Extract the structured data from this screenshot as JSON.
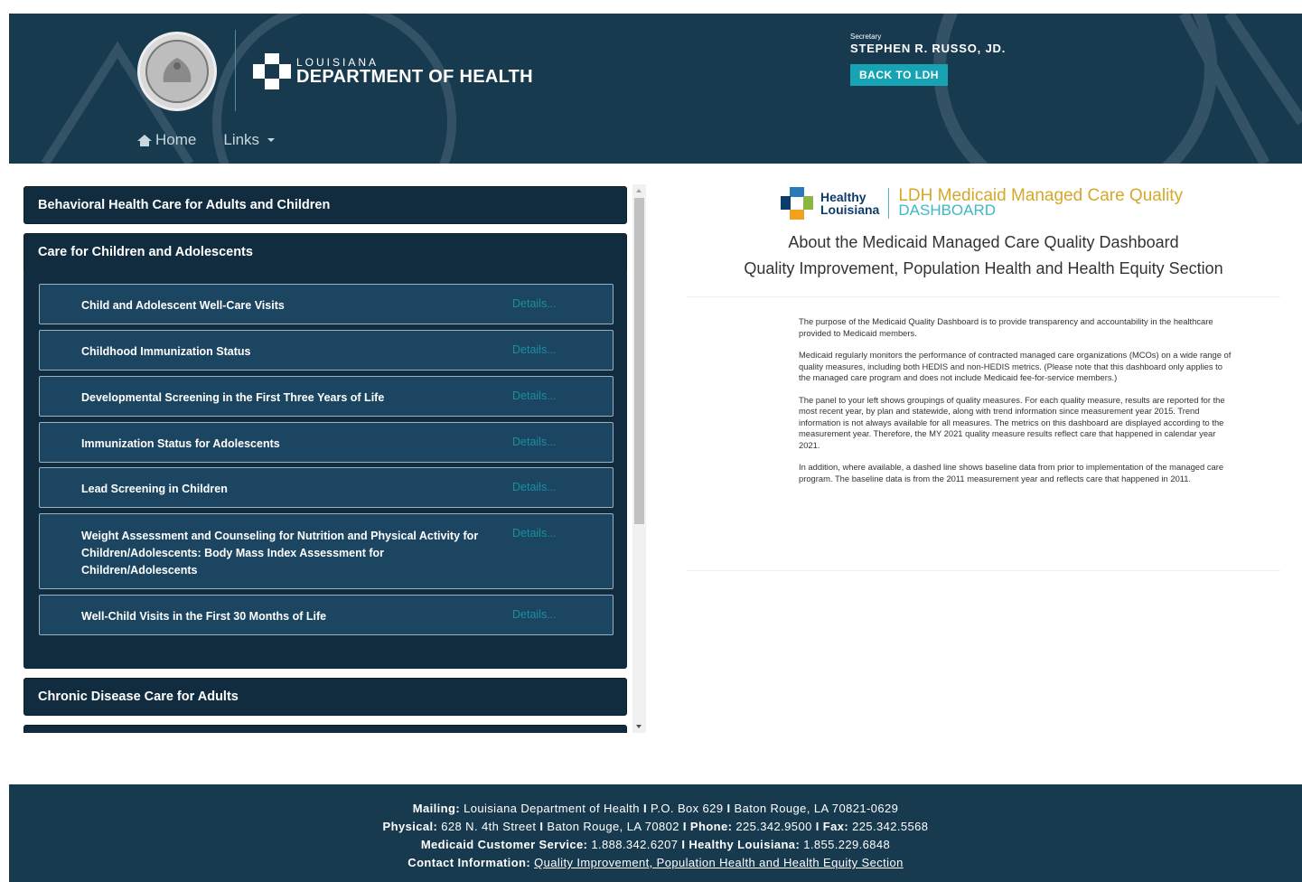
{
  "header": {
    "seal_alt": "State of Louisiana seal",
    "logo_small": "LOUISIANA",
    "logo_big": "DEPARTMENT OF HEALTH",
    "secretary_label": "Secretary",
    "secretary_name": "STEPHEN R. RUSSO, JD.",
    "back_button": "BACK TO LDH",
    "nav": [
      {
        "label": "Home",
        "icon": "home-icon"
      },
      {
        "label": "Links",
        "icon": "caret-down-icon"
      }
    ]
  },
  "accordion": {
    "sections": [
      {
        "title": "Behavioral Health Care for Adults and Children",
        "expanded": false
      },
      {
        "title": "Care for Children and Adolescents",
        "expanded": true
      },
      {
        "title": "Chronic Disease Care for Adults",
        "expanded": false
      }
    ],
    "measures": [
      {
        "name": "Child and Adolescent Well-Care Visits",
        "details": "Details..."
      },
      {
        "name": "Childhood Immunization Status",
        "details": "Details..."
      },
      {
        "name": "Developmental Screening in the First Three Years of Life",
        "details": "Details..."
      },
      {
        "name": "Immunization Status for Adolescents",
        "details": "Details..."
      },
      {
        "name": "Lead Screening in Children",
        "details": "Details..."
      },
      {
        "name": "Weight Assessment and Counseling for Nutrition and Physical Activity for Children/Adolescents: Body Mass Index Assessment for Children/Adolescents",
        "details": "Details..."
      },
      {
        "name": "Well-Child Visits in the First 30 Months of Life",
        "details": "Details..."
      }
    ]
  },
  "right": {
    "hl_line1": "Healthy",
    "hl_line2": "Louisiana",
    "dash_line1": "LDH Medicaid Managed Care Quality",
    "dash_line2": "DASHBOARD",
    "about_title": "About the Medicaid Managed Care Quality Dashboard",
    "about_subtitle": "Quality Improvement, Population Health and Health Equity Section",
    "paragraphs": [
      "The purpose of the Medicaid Quality Dashboard is to provide transparency and accountability in the healthcare provided to Medicaid members.",
      "Medicaid regularly monitors the performance of contracted managed care organizations (MCOs) on a wide range of quality measures, including both HEDIS and non-HEDIS metrics. (Please note that this dashboard only applies to the managed care program and does not include Medicaid fee-for-service members.)",
      "The panel to your left shows groupings of quality measures. For each quality measure, results are reported for the most recent year, by plan and statewide, along with trend information since measurement year 2015. Trend information is not always available for all measures. The metrics on this dashboard are displayed according to the measurement year. Therefore, the MY 2021 quality measure results reflect care that happened in calendar year 2021.",
      "In addition, where available, a dashed line shows baseline data from prior to implementation of the managed care program. The baseline data is from the 2011 measurement year and reflects care that happened in 2011."
    ]
  },
  "footer": {
    "mailing_label": "Mailing:",
    "mailing_1": "Louisiana Department of Health",
    "mailing_2": "P.O. Box 629",
    "mailing_3": "Baton Rouge, LA 70821-0629",
    "physical_label": "Physical:",
    "physical_1": "628 N. 4th Street",
    "physical_2": "Baton Rouge, LA 70802",
    "phone_label": "Phone:",
    "phone": "225.342.9500",
    "fax_label": "Fax:",
    "fax": "225.342.5568",
    "mcs_label": "Medicaid Customer Service:",
    "mcs": "1.888.342.6207",
    "hl_label": "Healthy Louisiana:",
    "hl": "1.855.229.6848",
    "contact_label": "Contact Information:",
    "contact_link": "Quality Improvement, Population Health and Health Equity Section",
    "separator": "I"
  }
}
